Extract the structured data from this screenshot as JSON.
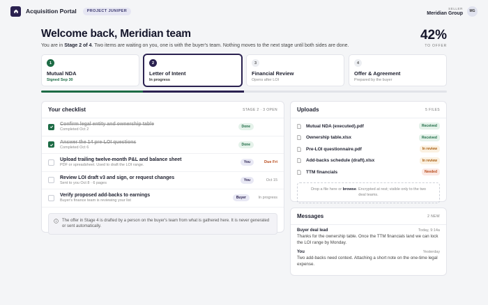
{
  "header": {
    "app_title": "Acquisition Portal",
    "project_badge": "PROJECT JUNIPER",
    "seller_label": "SELLER",
    "seller_name": "Meridian Group",
    "avatar_initials": "MG"
  },
  "welcome": {
    "title": "Welcome back, Meridian team",
    "sub_prefix": "You are in ",
    "sub_stage": "Stage 2 of 4",
    "sub_suffix": ". Two items are waiting on you, one is with the buyer's team. Nothing moves to the next stage until both sides are done."
  },
  "progress": {
    "percent_text": "42%",
    "label": "TO OFFER",
    "percent": 42
  },
  "stages": [
    {
      "num": "1",
      "title": "Mutual NDA",
      "sub": "Signed Sep 30",
      "state": "done"
    },
    {
      "num": "2",
      "title": "Letter of Intent",
      "sub": "In progress",
      "state": "active"
    },
    {
      "num": "3",
      "title": "Financial Review",
      "sub": "Opens after LOI",
      "state": "pending"
    },
    {
      "num": "4",
      "title": "Offer & Agreement",
      "sub": "Prepared by the buyer",
      "state": "pending"
    }
  ],
  "checklist": {
    "title": "Your checklist",
    "meta": "STAGE 2 · 3 OPEN",
    "items": [
      {
        "title": "Confirm legal entity and ownership table",
        "sub": "Completed Oct 2",
        "tag": "Done",
        "due": "",
        "done": true
      },
      {
        "title": "Answer the 14 pre-LOI questions",
        "sub": "Completed Oct 6",
        "tag": "Done",
        "due": "",
        "done": true
      },
      {
        "title": "Upload trailing twelve-month P&L and balance sheet",
        "sub": "PDF or spreadsheet. Used to draft the LOI range.",
        "tag": "You",
        "due": "Due Fri",
        "done": false
      },
      {
        "title": "Review LOI draft v3 and sign, or request changes",
        "sub": "Sent to you Oct 8 · 6 pages",
        "tag": "You",
        "due": "Oct 15",
        "done": false
      },
      {
        "title": "Verify proposed add-backs to earnings",
        "sub": "Buyer's finance team is reviewing your list",
        "tag": "Buyer",
        "due": "In progress",
        "done": false
      }
    ],
    "note": "The offer in Stage 4 is drafted by a person on the buyer's team from what is gathered here. It is never generated or sent automatically."
  },
  "uploads": {
    "title": "Uploads",
    "meta": "5 FILES",
    "files": [
      {
        "name": "Mutual NDA (executed).pdf",
        "status": "Received"
      },
      {
        "name": "Ownership table.xlsx",
        "status": "Received"
      },
      {
        "name": "Pre-LOI questionnaire.pdf",
        "status": "In review"
      },
      {
        "name": "Add-backs schedule (draft).xlsx",
        "status": "In review"
      },
      {
        "name": "TTM financials",
        "status": "Needed"
      }
    ],
    "drop_prefix": "Drop a file here or ",
    "drop_link": "browse",
    "drop_suffix": ". Encrypted at rest; visible only to the two deal teams."
  },
  "messages": {
    "title": "Messages",
    "meta": "2 NEW",
    "items": [
      {
        "from": "Buyer deal lead",
        "time": "Today, 9:14a",
        "body": "Thanks for the ownership table. Once the TTM financials land we can lock the LOI range by Monday."
      },
      {
        "from": "You",
        "time": "Yesterday",
        "body": "Two add-backs need context. Attaching a short note on the one-time legal expense."
      }
    ]
  },
  "colors": {
    "brand": "#2a2150",
    "done": "#1d6b45",
    "warning": "#a85d10",
    "urgent": "#b84a1a"
  }
}
